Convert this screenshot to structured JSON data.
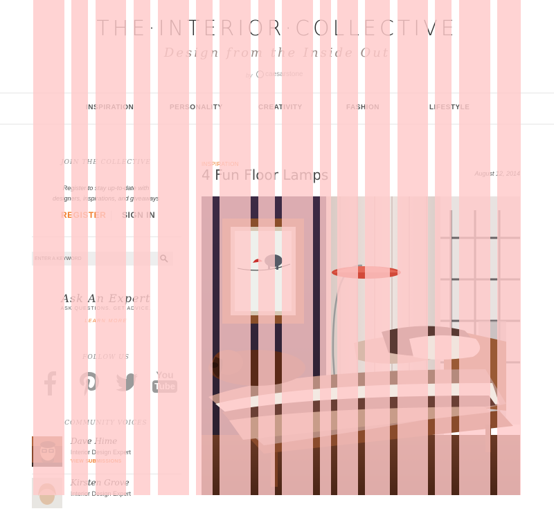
{
  "header": {
    "title": "THE·INTERIOR·COLLECTIVE",
    "tagline": "Design from the Inside Out",
    "by": "by",
    "brand": "caesarstone"
  },
  "nav": {
    "items": [
      {
        "label": "INSPIRATION"
      },
      {
        "label": "PERSONALITY"
      },
      {
        "label": "CREATIVITY"
      },
      {
        "label": "FASHION"
      },
      {
        "label": "LIFESTYLE"
      }
    ]
  },
  "sidebar": {
    "join_title": "JOIN THE COLLECTIVE",
    "join_text_line1": "Register to stay up-to-date with",
    "join_text_line2": "designers, inspirations, and giveaways",
    "register_label": "REGISTER",
    "signin_label": "SIGN IN",
    "search_placeholder": "ENTER A KEYWORD",
    "search_icon": "search-icon",
    "expert_title": "Ask An Expert",
    "expert_sub": "ASK QUESTIONS. GET ADVICE.",
    "expert_link": "LEARN MORE",
    "follow_title": "FOLLOW US",
    "social_icons": [
      "facebook-icon",
      "pinterest-icon",
      "twitter-icon",
      "youtube-icon"
    ],
    "youtube_text_top": "You",
    "youtube_text_bottom": "Tube",
    "community_title": "COMMUNITY VOICES",
    "voices": [
      {
        "name": "Dave Hime",
        "role": "Interior Design Expert",
        "link": "VIEW SUBMISSIONS"
      },
      {
        "name": "Kirsten Grove",
        "role": "Interior Design Expert"
      }
    ]
  },
  "post": {
    "category": "INSPIRATION",
    "title": "4 Fun Floor Lamps",
    "date": "August 12, 2014"
  },
  "colors": {
    "accent": "#f07c2a",
    "stripe_overlay": "#ffc9c9"
  }
}
